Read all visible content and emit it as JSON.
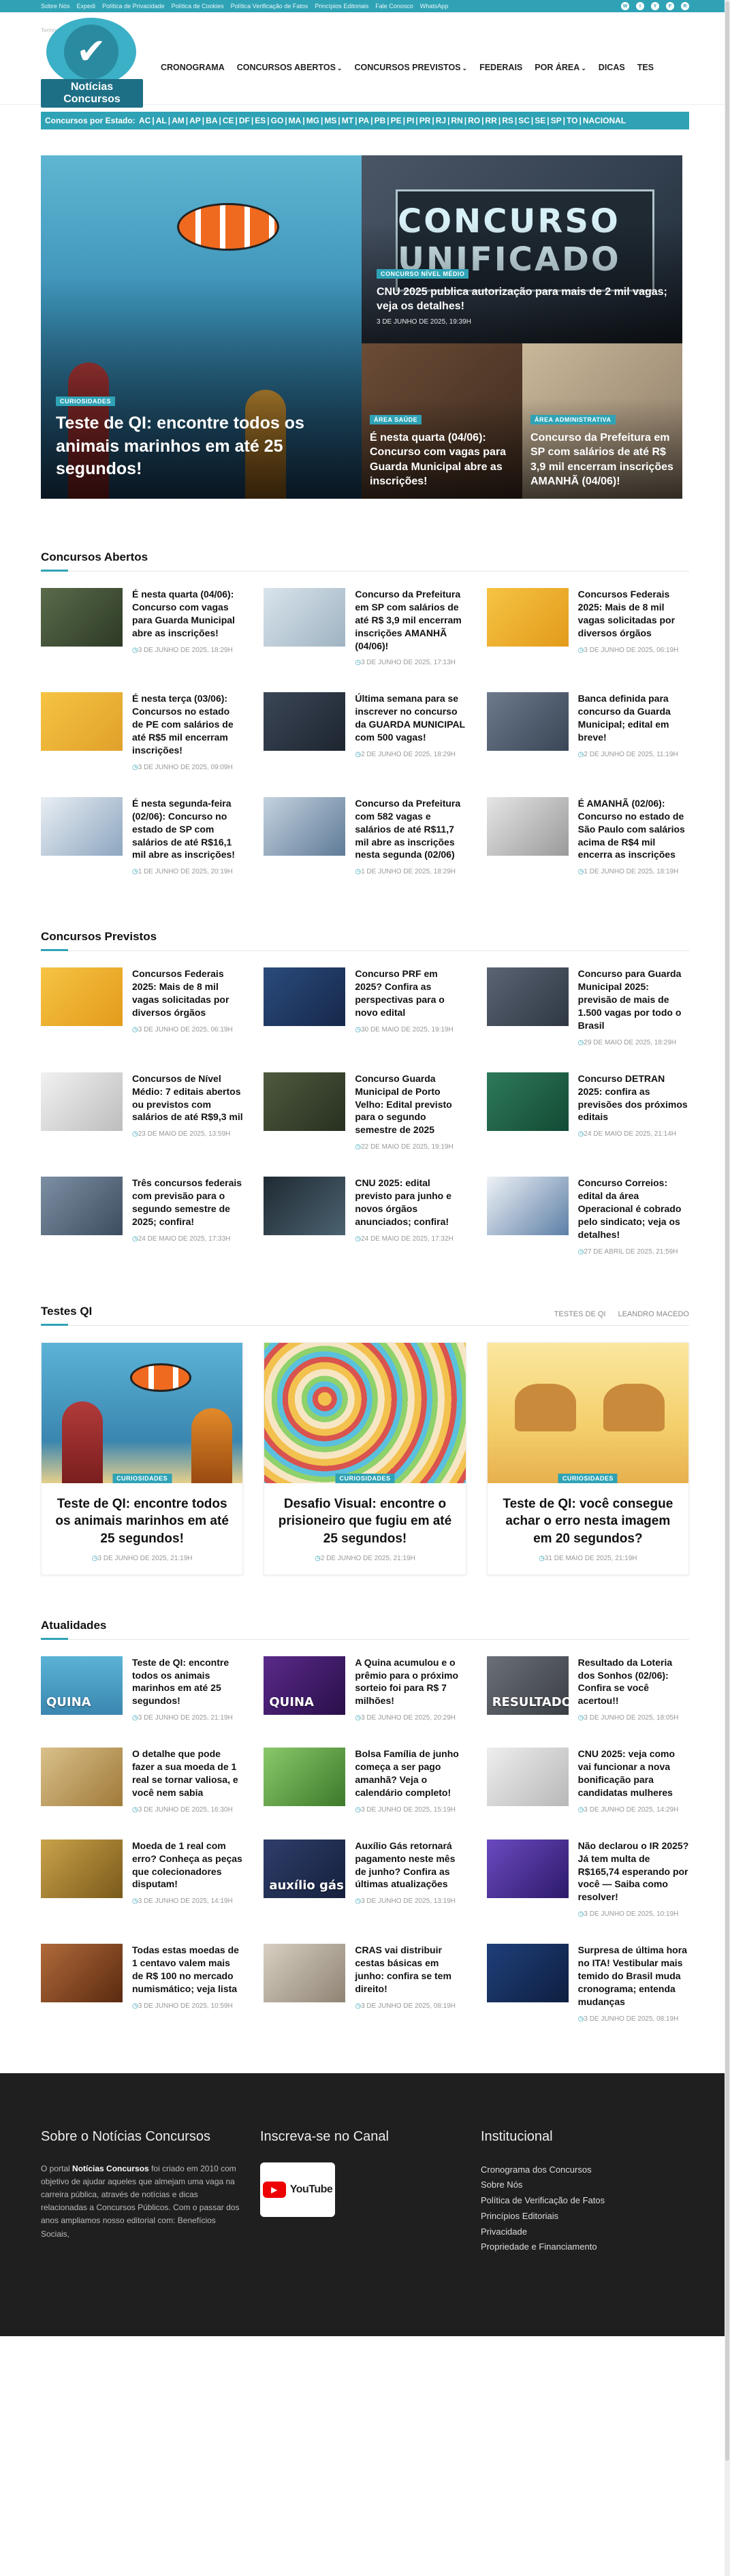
{
  "topbar": {
    "links": [
      "Sobre Nós",
      "Expedi",
      "Política de Privacidade",
      "Política de Cookies",
      "Política Verificação de Fatos",
      "Princípios Editoriais",
      "Fale Conosco",
      "WhatsApp"
    ],
    "social": [
      "W",
      "I",
      "Y",
      "F",
      "R"
    ],
    "colors": {
      "accent": "#2fa3b5"
    }
  },
  "header": {
    "logo_text": "Notícias Concursos",
    "tagline": "Termos de Serviço",
    "nav": [
      "CRONOGRAMA",
      "CONCURSOS ABERTOS",
      "CONCURSOS PREVISTOS",
      "FEDERAIS",
      "POR ÁREA",
      "DICAS",
      "TES"
    ]
  },
  "states": {
    "label": "Concursos por Estado:",
    "list": [
      "AC",
      "AL",
      "AM",
      "AP",
      "BA",
      "CE",
      "DF",
      "ES",
      "GO",
      "MA",
      "MG",
      "MS",
      "MT",
      "PA",
      "PB",
      "PE",
      "PI",
      "PR",
      "RJ",
      "RN",
      "RO",
      "RR",
      "RS",
      "SC",
      "SE",
      "SP",
      "TO",
      "NACIONAL"
    ]
  },
  "hero": {
    "main": {
      "badge": "CURIOSIDADES",
      "title": "Teste de QI: encontre todos os animais marinhos em até 25 segundos!"
    },
    "top_right": {
      "billboard": "CONCURSO UNIFICADO",
      "badge": "CONCURSO NÍVEL MÉDIO",
      "title": "CNU 2025 publica autorização para mais de 2 mil vagas; veja os detalhes!",
      "date": "3 DE JUNHO DE 2025, 19:39H"
    },
    "bottom_left": {
      "badge": "ÁREA SAÚDE",
      "title": "É nesta quarta (04/06): Concurso com vagas para Guarda Municipal abre as inscrições!"
    },
    "bottom_right": {
      "badge": "ÁREA ADMINISTRATIVA",
      "title": "Concurso da Prefeitura em SP com salários de até R$ 3,9 mil encerram inscrições AMANHÃ (04/06)!"
    }
  },
  "abertos": {
    "title": "Concursos Abertos",
    "items": [
      {
        "title": "É nesta quarta (04/06): Concurso com vagas para Guarda Municipal abre as inscrições!",
        "date": "3 DE JUNHO DE 2025, 18:29H"
      },
      {
        "title": "Concurso da Prefeitura em SP com salários de até R$ 3,9 mil encerram inscrições AMANHÃ (04/06)!",
        "date": "3 DE JUNHO DE 2025, 17:13H"
      },
      {
        "title": "Concursos Federais 2025: Mais de 8 mil vagas solicitadas por diversos órgãos",
        "date": "3 DE JUNHO DE 2025, 06:19H"
      },
      {
        "title": "É nesta terça (03/06): Concursos no estado de PE com salários de até R$5 mil encerram inscrições!",
        "date": "3 DE JUNHO DE 2025, 09:09H"
      },
      {
        "title": "Última semana para se inscrever no concurso da GUARDA MUNICIPAL com 500 vagas!",
        "date": "2 DE JUNHO DE 2025, 18:29H"
      },
      {
        "title": "Banca definida para concurso da Guarda Municipal; edital em breve!",
        "date": "2 DE JUNHO DE 2025, 11:19H"
      },
      {
        "title": "É nesta segunda-feira (02/06): Concurso no estado de SP com salários de até R$16,1 mil abre as inscrições!",
        "date": "1 DE JUNHO DE 2025, 20:19H"
      },
      {
        "title": "Concurso da Prefeitura com 582 vagas e salários de até R$11,7 mil abre as inscrições nesta segunda (02/06)",
        "date": "1 DE JUNHO DE 2025, 18:29H"
      },
      {
        "title": "É AMANHÃ (02/06): Concurso no estado de São Paulo com salários acima de R$4 mil encerra as inscrições",
        "date": "1 DE JUNHO DE 2025, 18:19H"
      }
    ]
  },
  "previstos": {
    "title": "Concursos Previstos",
    "items": [
      {
        "title": "Concursos Federais 2025: Mais de 8 mil vagas solicitadas por diversos órgãos",
        "date": "3 DE JUNHO DE 2025, 06:19H"
      },
      {
        "title": "Concurso PRF em 2025? Confira as perspectivas para o novo edital",
        "date": "30 DE MAIO DE 2025, 19:19H"
      },
      {
        "title": "Concurso para Guarda Municipal 2025: previsão de mais de 1.500 vagas por todo o Brasil",
        "date": "29 DE MAIO DE 2025, 18:29H"
      },
      {
        "title": "Concursos de Nível Médio: 7 editais abertos ou previstos com salários de até R$9,3 mil",
        "date": "23 DE MAIO DE 2025, 13:59H"
      },
      {
        "title": "Concurso Guarda Municipal de Porto Velho: Edital previsto para o segundo semestre de 2025",
        "date": "22 DE MAIO DE 2025, 19:19H"
      },
      {
        "title": "Concurso DETRAN 2025: confira as previsões dos próximos editais",
        "date": "24 DE MAIO DE 2025, 21:14H"
      },
      {
        "title": "Três concursos federais com previsão para o segundo semestre de 2025; confira!",
        "date": "24 DE MAIO DE 2025, 17:33H"
      },
      {
        "title": "CNU 2025: edital previsto para junho e novos órgãos anunciados; confira!",
        "date": "24 DE MAIO DE 2025, 17:32H"
      },
      {
        "title": "Concurso Correios: edital da área Operacional é cobrado pelo sindicato; veja os detalhes!",
        "date": "27 DE ABRIL DE 2025, 21:59H"
      }
    ]
  },
  "testes": {
    "title": "Testes QI",
    "tabs": [
      "TESTES DE QI",
      "LEANDRO MACEDO"
    ],
    "cards": [
      {
        "badge": "CURIOSIDADES",
        "title": "Teste de QI: encontre todos os animais marinhos em até 25 segundos!",
        "date": "3 DE JUNHO DE 2025, 21:19H"
      },
      {
        "badge": "CURIOSIDADES",
        "title": "Desafio Visual: encontre o prisioneiro que fugiu em até 25 segundos!",
        "date": "2 DE JUNHO DE 2025, 21:19H"
      },
      {
        "badge": "CURIOSIDADES",
        "title": "Teste de QI: você consegue achar o erro nesta imagem em 20 segundos?",
        "date": "31 DE MAIO DE 2025, 21:19H"
      }
    ]
  },
  "atualidades": {
    "title": "Atualidades",
    "items": [
      {
        "title": "Teste de QI: encontre todos os animais marinhos em até 25 segundos!",
        "date": "3 DE JUNHO DE 2025, 21:19H",
        "thumb": "QUINA"
      },
      {
        "title": "A Quina acumulou e o prêmio para o próximo sorteio foi para R$ 7 milhões!",
        "date": "3 DE JUNHO DE 2025, 20:29H",
        "thumb": "QUINA"
      },
      {
        "title": "Resultado da Loteria dos Sonhos (02/06): Confira se você acertou!!",
        "date": "3 DE JUNHO DE 2025, 18:05H",
        "thumb": "RESULTADO"
      },
      {
        "title": "O detalhe que pode fazer a sua moeda de 1 real se tornar valiosa, e você nem sabia",
        "date": "3 DE JUNHO DE 2025, 16:30H",
        "thumb": ""
      },
      {
        "title": "Bolsa Família de junho começa a ser pago amanhã? Veja o calendário completo!",
        "date": "3 DE JUNHO DE 2025, 15:19H",
        "thumb": ""
      },
      {
        "title": "CNU 2025: veja como vai funcionar a nova bonificação para candidatas mulheres",
        "date": "3 DE JUNHO DE 2025, 14:29H",
        "thumb": ""
      },
      {
        "title": "Moeda de 1 real com erro? Conheça as peças que colecionadores disputam!",
        "date": "3 DE JUNHO DE 2025, 14:19H",
        "thumb": ""
      },
      {
        "title": "Auxílio Gás retornará pagamento neste mês de junho? Confira as últimas atualizações",
        "date": "3 DE JUNHO DE 2025, 13:19H",
        "thumb": "auxílio gás"
      },
      {
        "title": "Não declarou o IR 2025? Já tem multa de R$165,74 esperando por você — Saiba como resolver!",
        "date": "3 DE JUNHO DE 2025, 10:19H",
        "thumb": ""
      },
      {
        "title": "Todas estas moedas de 1 centavo valem mais de R$ 100 no mercado numismático; veja lista",
        "date": "3 DE JUNHO DE 2025, 10:59H",
        "thumb": ""
      },
      {
        "title": "CRAS vai distribuir cestas básicas em junho: confira se tem direito!",
        "date": "3 DE JUNHO DE 2025, 08:19H",
        "thumb": ""
      },
      {
        "title": "Surpresa de última hora no ITA! Vestibular mais temido do Brasil muda cronograma; entenda mudanças",
        "date": "3 DE JUNHO DE 2025, 08:19H",
        "thumb": ""
      }
    ]
  },
  "footer": {
    "about_title": "Sobre o Notícias Concursos",
    "about_text_pre": "O portal ",
    "about_brand": "Notícias Concursos",
    "about_text_post": " foi criado em 2010 com objetivo de ajudar aqueles que almejam uma vaga na carreira pública, através de notícias e dicas relacionadas a Concursos Públicos. Com o passar dos anos ampliamos nosso editorial com: Benefícios Sociais,",
    "subscribe_title": "Inscreva-se no Canal",
    "youtube_label": "YouTube",
    "inst_title": "Institucional",
    "inst_links": [
      "Cronograma dos Concursos",
      "Sobre Nós",
      "Política de Verificação de Fatos",
      "Princípios Editoriais",
      "Privacidade",
      "Propriedade e Financiamento"
    ]
  }
}
